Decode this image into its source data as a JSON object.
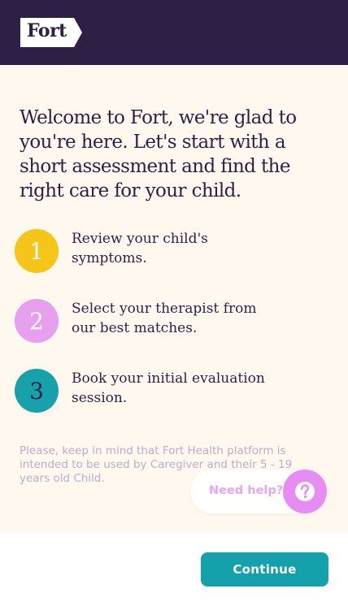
{
  "header": {
    "logo_text": "Fort",
    "bg_color": "#2E1F45"
  },
  "main": {
    "headline": "Welcome to Fort, we're glad to you're here. Let's start with a short assessment and find the right care for your child.",
    "steps": [
      {
        "number": "1",
        "text": "Review your child's symptoms.",
        "circle_color": "#F5C518",
        "number_color": "#FFFFFF"
      },
      {
        "number": "2",
        "text": "Select your therapist from our best matches.",
        "circle_color": "#E7A0EE",
        "number_color": "#FFFFFF"
      },
      {
        "number": "3",
        "text": "Book your initial evaluation session.",
        "circle_color": "#16A1AB",
        "number_color": "#2E1F45"
      }
    ],
    "disclaimer": "Please, keep in mind that Fort Health platform is intended to be used by Caregiver and their 5 - 19 years old Child."
  },
  "help_widget": {
    "label": "Need help?",
    "icon": "question-mark-icon",
    "color": "#E68CF3"
  },
  "footer": {
    "continue_label": "Continue",
    "button_color": "#14A1AB"
  }
}
